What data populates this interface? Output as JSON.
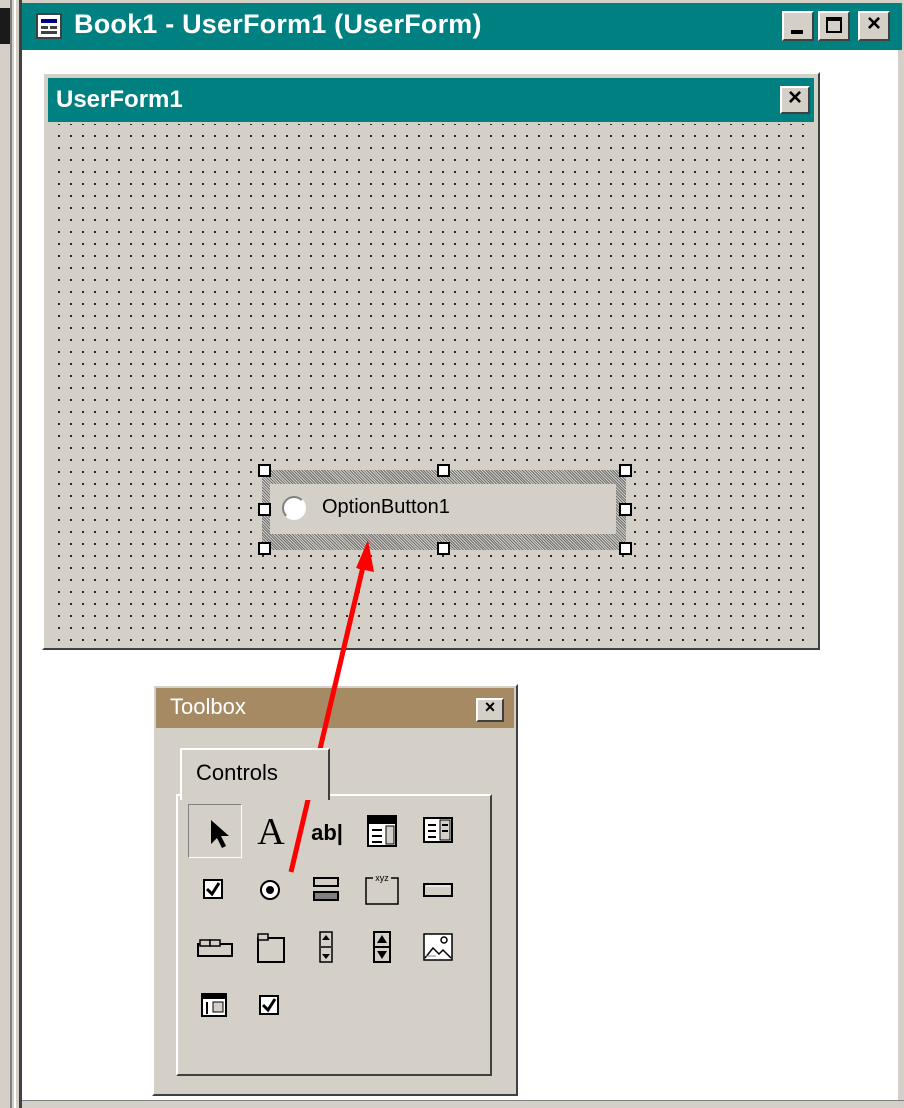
{
  "designer_window": {
    "title": "Book1 - UserForm1 (UserForm)",
    "icon": "userform-designer-icon",
    "caption_buttons": {
      "minimize": "minimize-icon",
      "maximize": "maximize-icon",
      "close": "×"
    }
  },
  "userform": {
    "title": "UserForm1",
    "close": "×",
    "selected_control": {
      "label": "OptionButton1",
      "type": "option-button"
    }
  },
  "toolbox": {
    "title": "Toolbox",
    "close": "×",
    "tab": "Controls",
    "tools": [
      {
        "name": "select-objects-tool",
        "icon": "pointer-arrow-icon",
        "pressed": true
      },
      {
        "name": "label-tool",
        "icon": "label-A-icon",
        "glyph": "A"
      },
      {
        "name": "textbox-tool",
        "icon": "textbox-icon",
        "glyph": "ab|"
      },
      {
        "name": "combobox-tool",
        "icon": "combobox-icon"
      },
      {
        "name": "listbox-tool",
        "icon": "listbox-icon"
      },
      {
        "name": "checkbox-tool",
        "icon": "checkbox-icon"
      },
      {
        "name": "optionbutton-tool",
        "icon": "option-button-icon"
      },
      {
        "name": "togglebutton-tool",
        "icon": "toggle-button-icon"
      },
      {
        "name": "frame-tool",
        "icon": "frame-icon",
        "glyph": "xyz"
      },
      {
        "name": "commandbutton-tool",
        "icon": "command-button-icon"
      },
      {
        "name": "tabstrip-tool",
        "icon": "tabstrip-icon"
      },
      {
        "name": "multipage-tool",
        "icon": "multipage-icon"
      },
      {
        "name": "scrollbar-tool",
        "icon": "scrollbar-icon"
      },
      {
        "name": "spinbutton-tool",
        "icon": "spinbutton-icon"
      },
      {
        "name": "image-tool",
        "icon": "image-icon"
      },
      {
        "name": "refedit-tool",
        "icon": "refedit-icon"
      },
      {
        "name": "checkbox-extra-tool",
        "icon": "checkbox-icon"
      }
    ]
  },
  "annotation": {
    "arrow_color": "#ff0000",
    "from": "optionbutton-tool",
    "to": "selected_control"
  },
  "colors": {
    "titlebar_teal": "#008080",
    "toolbox_titlebar": "#a68a64",
    "face": "#d4d0c8"
  }
}
